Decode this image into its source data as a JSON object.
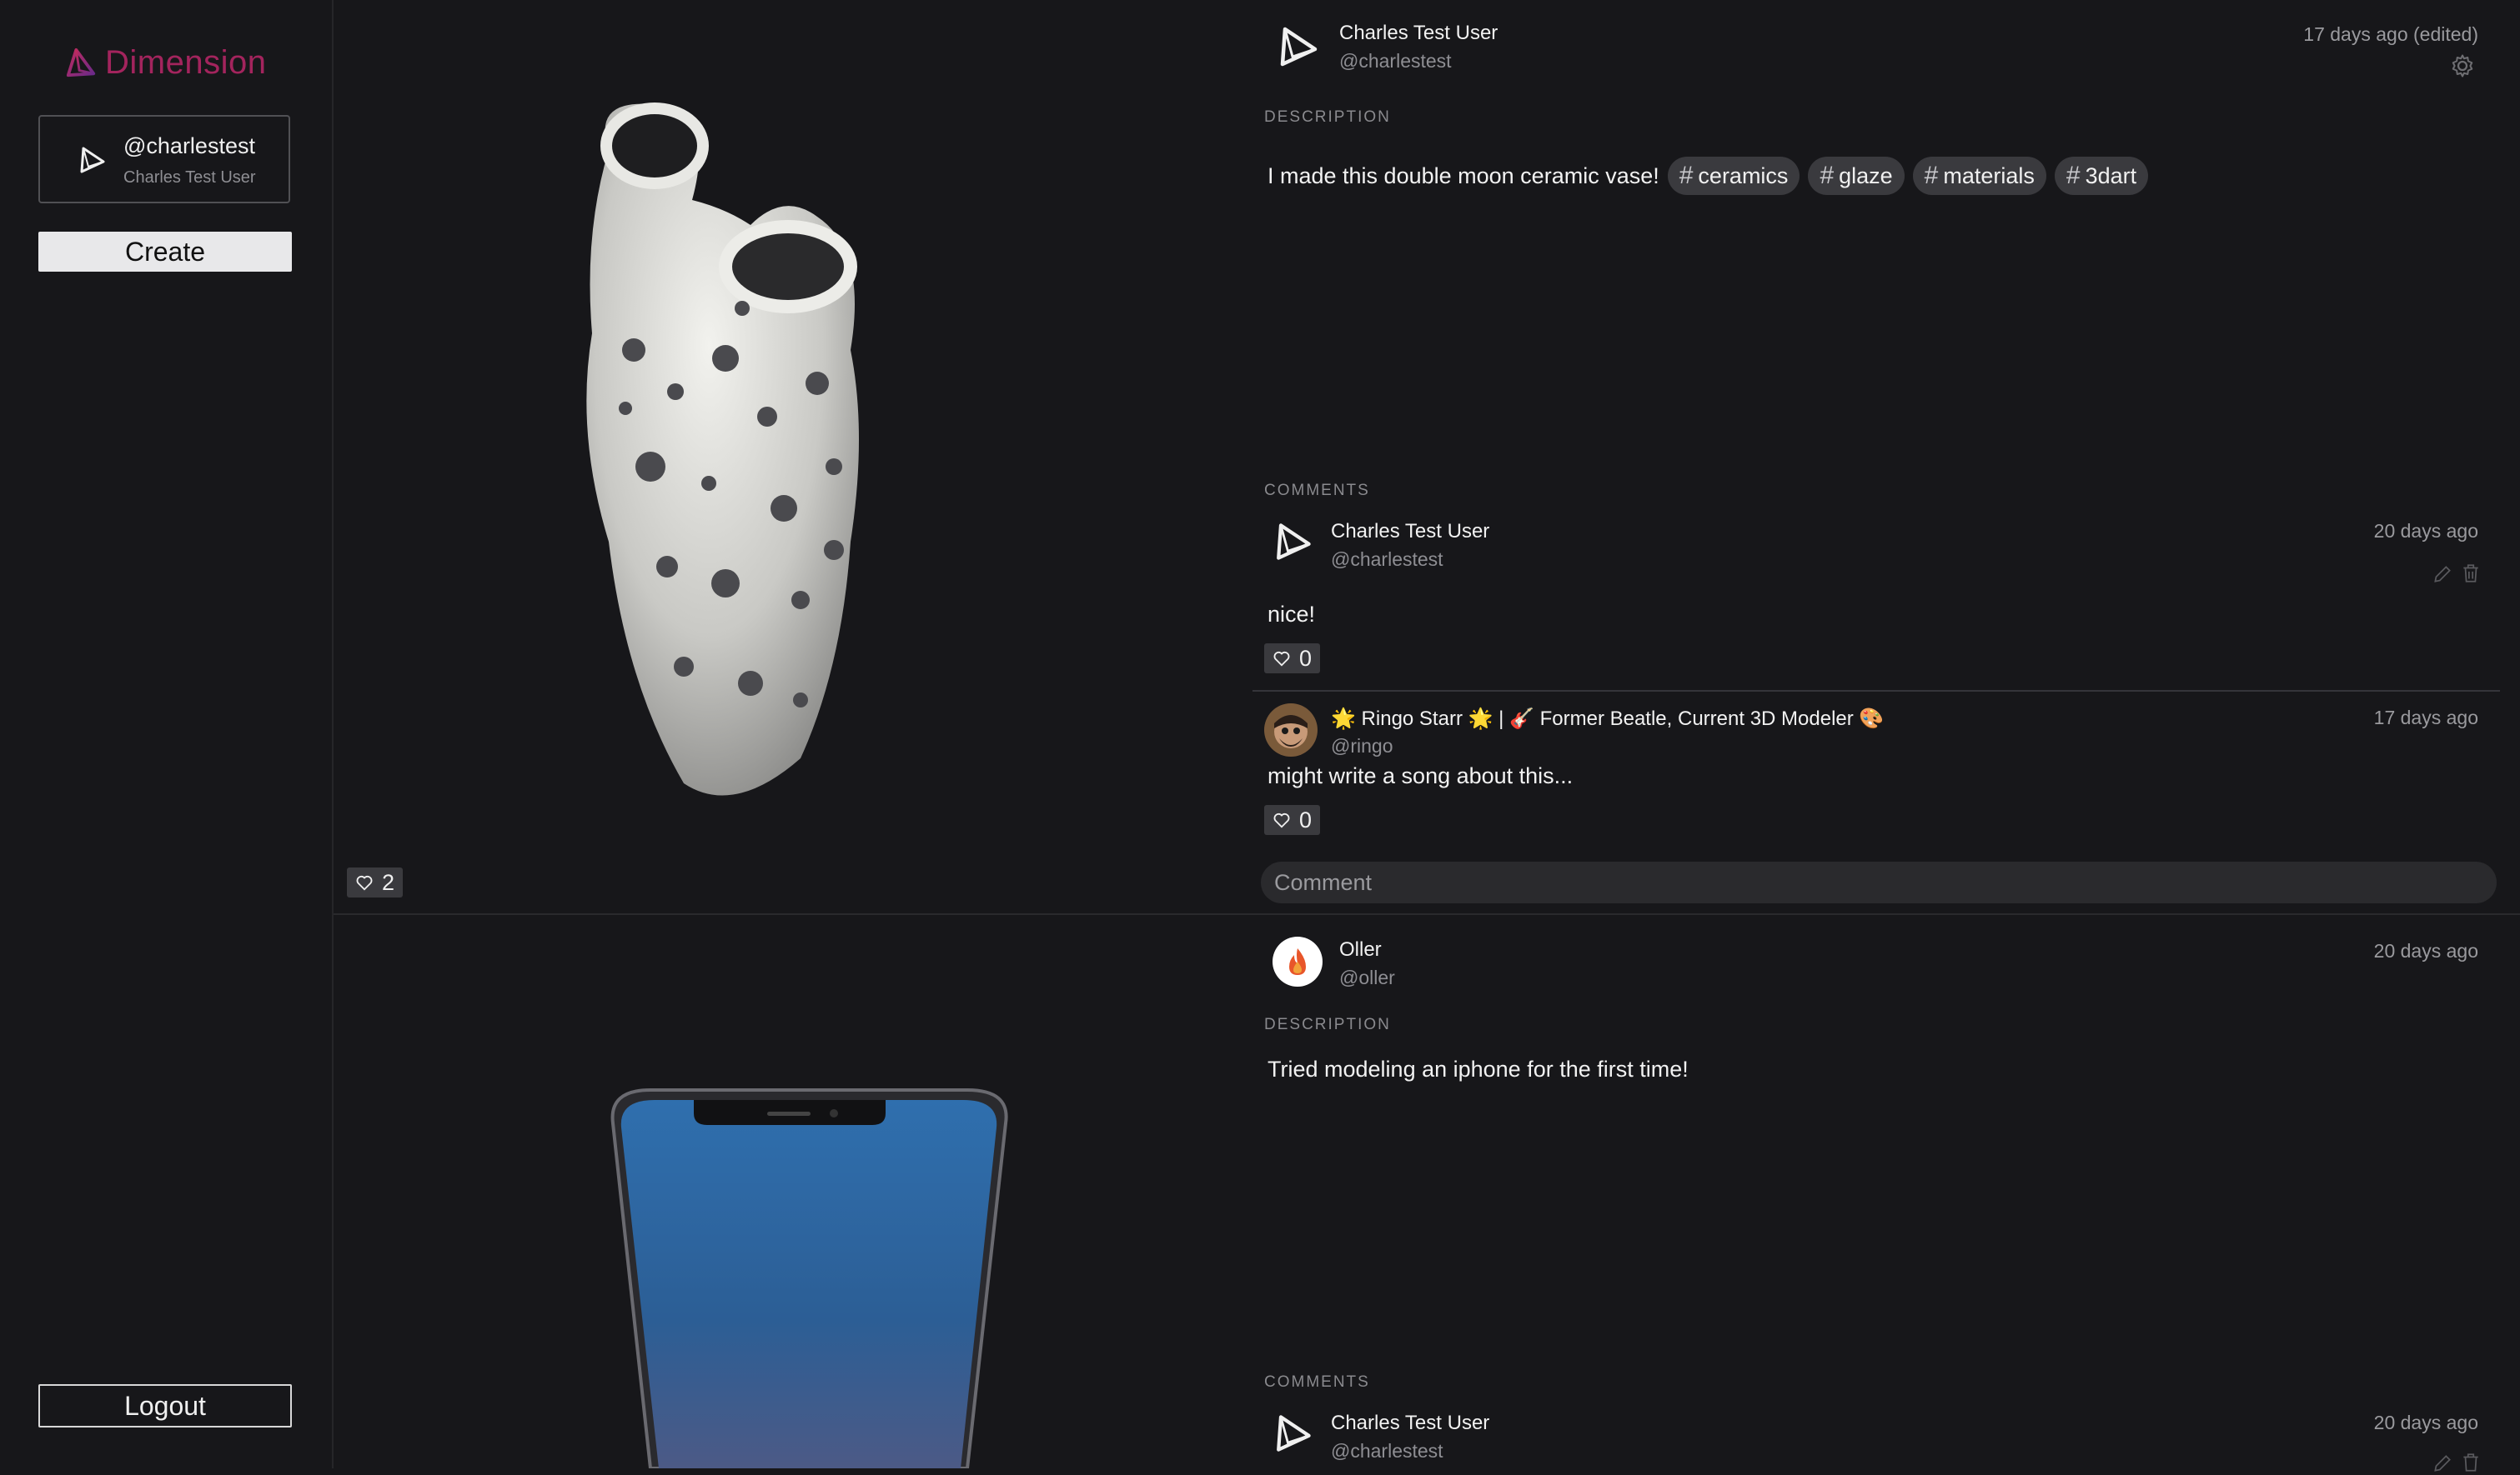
{
  "app": {
    "brand": "Dimension",
    "brand_color": "#a3245d"
  },
  "sidebar": {
    "user_handle": "@charlestest",
    "user_name": "Charles Test User",
    "create_label": "Create",
    "logout_label": "Logout"
  },
  "posts": [
    {
      "author_name": "Charles Test User",
      "author_handle": "@charlestest",
      "time": "17 days ago (edited)",
      "description_label": "DESCRIPTION",
      "description": "I made this double moon ceramic vase!",
      "tags": [
        "ceramics",
        "glaze",
        "materials",
        "3dart"
      ],
      "likes": "2",
      "comments_label": "COMMENTS",
      "comment_placeholder": "Comment",
      "comments": [
        {
          "author_name": "Charles Test User",
          "author_handle": "@charlestest",
          "time": "20 days ago",
          "text": "nice!",
          "likes": "0"
        },
        {
          "author_name": "🌟 Ringo Starr 🌟 | 🎸 Former Beatle, Current 3D Modeler 🎨",
          "author_handle": "@ringo",
          "time": "17 days ago",
          "text": "might write a song about this...",
          "likes": "0"
        }
      ]
    },
    {
      "author_name": "Oller",
      "author_handle": "@oller",
      "time": "20 days ago",
      "description_label": "DESCRIPTION",
      "description": "Tried modeling an iphone for the first time!",
      "comments_label": "COMMENTS",
      "comments": [
        {
          "author_name": "Charles Test User",
          "author_handle": "@charlestest",
          "time": "20 days ago"
        }
      ]
    }
  ],
  "icons": {
    "like": "heart-icon",
    "settings": "gear-icon",
    "edit": "pencil-icon",
    "delete": "trash-icon"
  }
}
